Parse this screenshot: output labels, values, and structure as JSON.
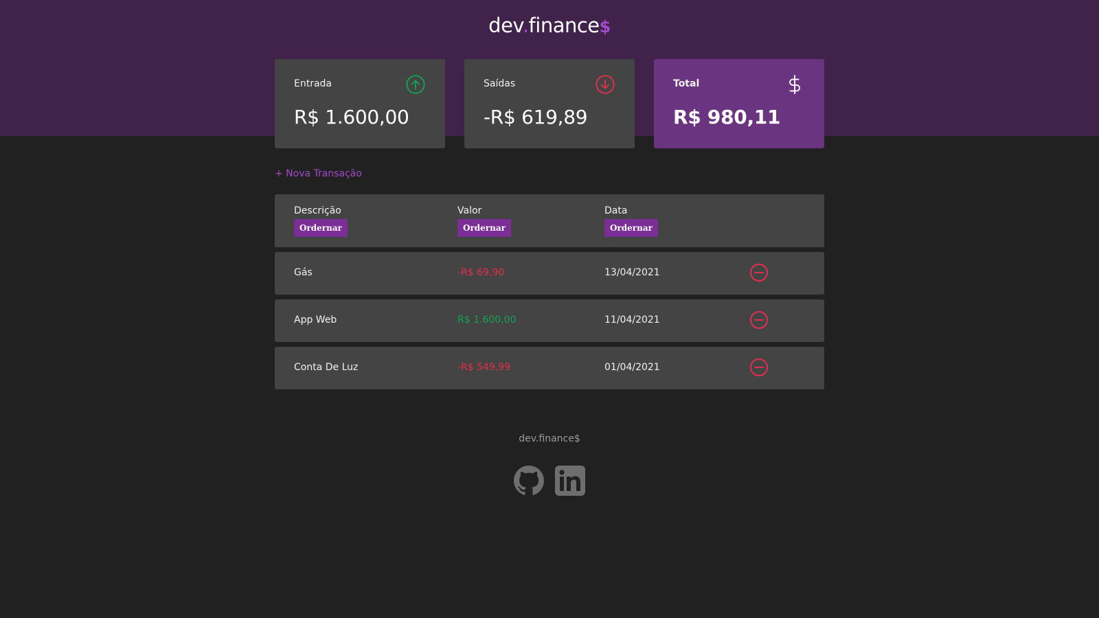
{
  "brand": {
    "name_part1": "dev",
    "name_dot": ".",
    "name_part2": "finance",
    "name_symbol": "$"
  },
  "colors": {
    "header_bg": "#41224b",
    "accent": "#a349c9",
    "income": "#12a454",
    "expense": "#e52e4d",
    "total_card": "#6b3480"
  },
  "summary": {
    "income": {
      "label": "Entrada",
      "value": "R$ 1.600,00",
      "icon": "arrow-up-circle-icon"
    },
    "expense": {
      "label": "Saídas",
      "value": "-R$ 619,89",
      "icon": "arrow-down-circle-icon"
    },
    "total": {
      "label": "Total",
      "value": "R$ 980,11",
      "icon": "dollar-sign-icon"
    }
  },
  "actions": {
    "new_transaction": "+ Nova Transação"
  },
  "table": {
    "columns": [
      {
        "label": "Descrição",
        "sort_label": "Ordernar"
      },
      {
        "label": "Valor",
        "sort_label": "Ordernar"
      },
      {
        "label": "Data",
        "sort_label": "Ordernar"
      }
    ],
    "rows": [
      {
        "description": "Gás",
        "amount": "-R$ 69,90",
        "date": "13/04/2021",
        "type": "expense"
      },
      {
        "description": "App Web",
        "amount": "R$ 1.600,00",
        "date": "11/04/2021",
        "type": "income"
      },
      {
        "description": "Conta De Luz",
        "amount": "-R$ 549,99",
        "date": "01/04/2021",
        "type": "expense"
      }
    ]
  },
  "footer": {
    "title": "dev.finance$",
    "socials": [
      {
        "icon": "github-icon"
      },
      {
        "icon": "linkedin-icon"
      }
    ]
  }
}
